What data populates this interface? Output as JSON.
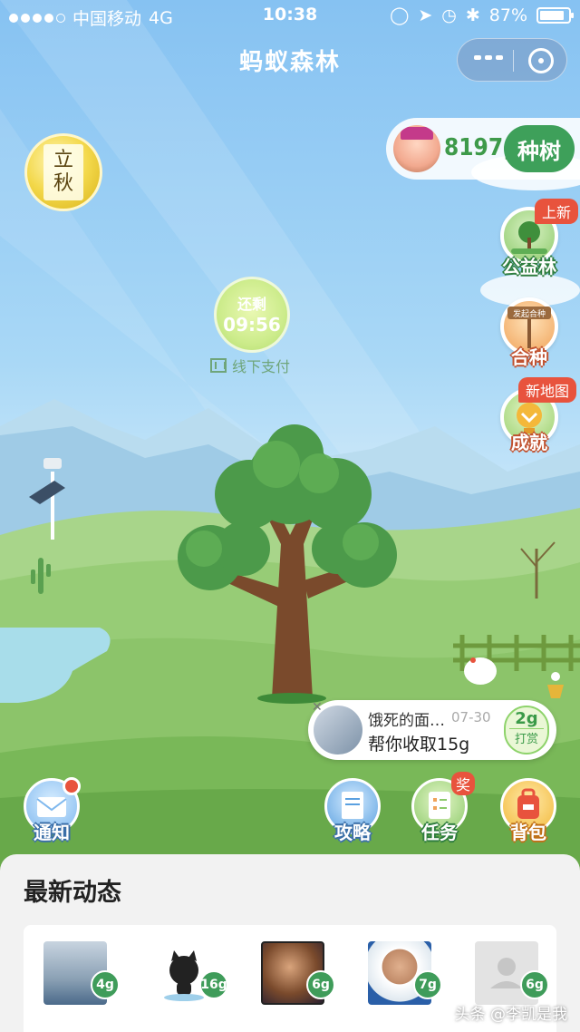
{
  "status_bar": {
    "carrier": "中国移动",
    "network": "4G",
    "time": "10:38",
    "battery": "87%"
  },
  "nav": {
    "title": "蚂蚁森林"
  },
  "season": {
    "line1": "立",
    "line2": "秋"
  },
  "energy": {
    "amount": "8197g",
    "plant_label": "种树"
  },
  "side_buttons": {
    "public_forest": {
      "label": "公益林",
      "tag": "上新"
    },
    "co_plant": {
      "label": "合种",
      "sign": "发起合种"
    },
    "achievement": {
      "label": "成就",
      "tag": "新地图"
    }
  },
  "countdown": {
    "label": "还剩",
    "value": "09:56"
  },
  "offline_pay": {
    "label": "线下支付"
  },
  "collect_notice": {
    "name": "饿死的面…",
    "date": "07-30",
    "message": "帮你收取15g",
    "amount": "2g",
    "reward_label": "打赏"
  },
  "actions": {
    "notify": {
      "label": "通知"
    },
    "guide": {
      "label": "攻略"
    },
    "tasks": {
      "label": "任务",
      "badge": "奖"
    },
    "bag": {
      "label": "背包"
    }
  },
  "feed": {
    "title": "最新动态",
    "friends": [
      {
        "energy": "4g"
      },
      {
        "energy": "16g"
      },
      {
        "energy": "6g"
      },
      {
        "energy": "7g"
      },
      {
        "energy": "6g"
      }
    ]
  },
  "watermark": "头条 @李凯是我",
  "colors": {
    "accent_green": "#3ea05a",
    "energy_text": "#3e9a4a",
    "tag_red": "#e8533d"
  }
}
